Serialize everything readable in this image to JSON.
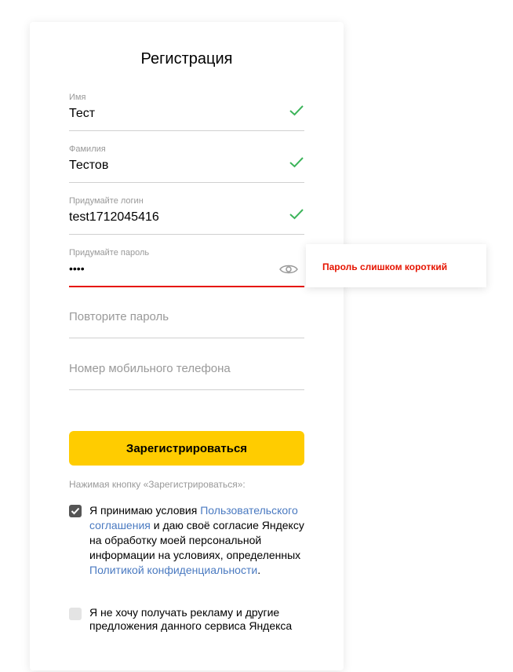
{
  "form": {
    "title": "Регистрация",
    "first_name": {
      "label": "Имя",
      "value": "Тест"
    },
    "last_name": {
      "label": "Фамилия",
      "value": "Тестов"
    },
    "login": {
      "label": "Придумайте логин",
      "value": "test1712045416"
    },
    "password": {
      "label": "Придумайте пароль",
      "value": "••••"
    },
    "repeat_password": {
      "placeholder": "Повторите пароль"
    },
    "phone": {
      "placeholder": "Номер мобильного телефона"
    },
    "password_error": "Пароль слишком короткий",
    "submit_label": "Зарегистрироваться",
    "note": "Нажимая кнопку «Зарегистрироваться»:",
    "agreement": {
      "text1": "Я принимаю условия ",
      "link1": "Пользовательского соглашения",
      "text2": " и даю своё согласие Яндексу на обработку моей персональной информации на условиях, определенных ",
      "link2": "Политикой конфиденциальности",
      "text3": ".",
      "checked": true
    },
    "ads": {
      "text": "Я не хочу получать рекламу и другие предложения данного сервиса Яндекса",
      "checked": false
    }
  },
  "colors": {
    "accent_yellow": "#ffcc00",
    "error_red": "#e61400",
    "link_blue": "#4a7ac1",
    "success_green": "#3cb45a"
  }
}
